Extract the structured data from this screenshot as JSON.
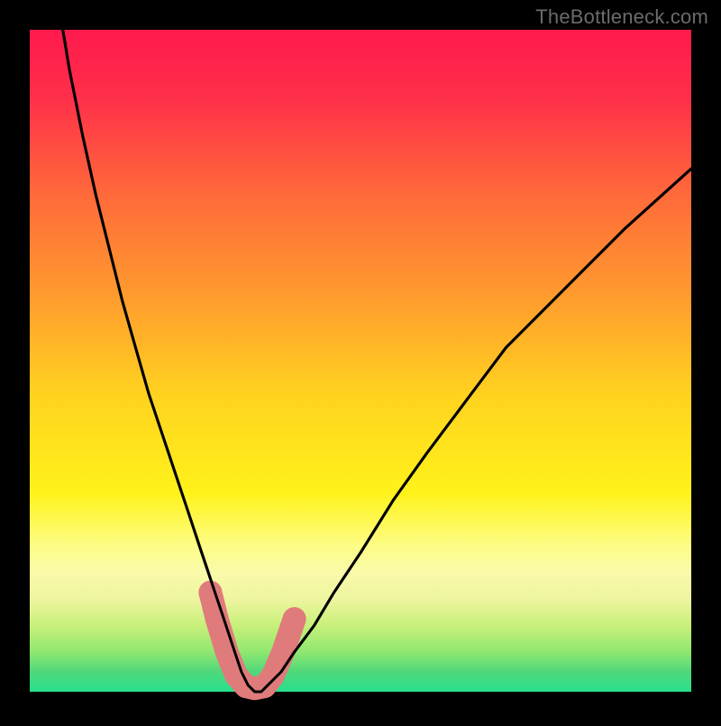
{
  "watermark": {
    "text": "TheBottleneck.com"
  },
  "frame": {
    "outer_w": 800,
    "outer_h": 800,
    "inner_x": 33,
    "inner_y": 33,
    "inner_w": 734,
    "inner_h": 734,
    "black": "#000000"
  },
  "gradient": {
    "stops": [
      {
        "pos": 0.0,
        "color": "#ff1a4c"
      },
      {
        "pos": 0.1,
        "color": "#ff2e4a"
      },
      {
        "pos": 0.25,
        "color": "#ff6a3a"
      },
      {
        "pos": 0.4,
        "color": "#ff9a2e"
      },
      {
        "pos": 0.55,
        "color": "#ffd21f"
      },
      {
        "pos": 0.7,
        "color": "#fff21a"
      },
      {
        "pos": 0.78,
        "color": "#fdfd86"
      },
      {
        "pos": 0.82,
        "color": "#f9faaa"
      },
      {
        "pos": 0.86,
        "color": "#eef5a0"
      },
      {
        "pos": 0.9,
        "color": "#c8f07a"
      },
      {
        "pos": 0.94,
        "color": "#8fe770"
      },
      {
        "pos": 0.97,
        "color": "#4fd87a"
      },
      {
        "pos": 1.0,
        "color": "#27e08e"
      }
    ]
  },
  "colors": {
    "curve": "#000000",
    "marker_fill": "#e07b7b",
    "marker_stroke": "#c76a6a"
  },
  "chart_data": {
    "type": "line",
    "title": "",
    "xlabel": "",
    "ylabel": "",
    "xlim": [
      0,
      100
    ],
    "ylim": [
      0,
      100
    ],
    "grid": false,
    "legend": "none",
    "series": [
      {
        "name": "bottleneck-curve",
        "x": [
          5,
          6,
          8,
          10,
          12,
          14,
          16,
          18,
          20,
          22,
          24,
          26,
          27,
          28,
          29,
          30,
          31,
          32,
          33,
          34,
          35,
          36,
          38,
          40,
          43,
          46,
          50,
          55,
          60,
          66,
          72,
          80,
          90,
          100
        ],
        "y": [
          100,
          94,
          84,
          75,
          67,
          59,
          52,
          45,
          39,
          33,
          27,
          21,
          18,
          15,
          12,
          9,
          6,
          3,
          1,
          0,
          0,
          1,
          3,
          6,
          10,
          15,
          21,
          29,
          36,
          44,
          52,
          60,
          70,
          79
        ]
      }
    ],
    "markers": {
      "name": "bottleneck-highlight",
      "x": [
        27.3,
        28.3,
        29.8,
        31.2,
        32.7,
        34.0,
        35.5,
        36.8,
        38.3,
        40.0
      ],
      "y": [
        15.0,
        11.0,
        6.0,
        2.5,
        0.8,
        0.5,
        0.8,
        2.5,
        6.0,
        11.0
      ]
    }
  }
}
